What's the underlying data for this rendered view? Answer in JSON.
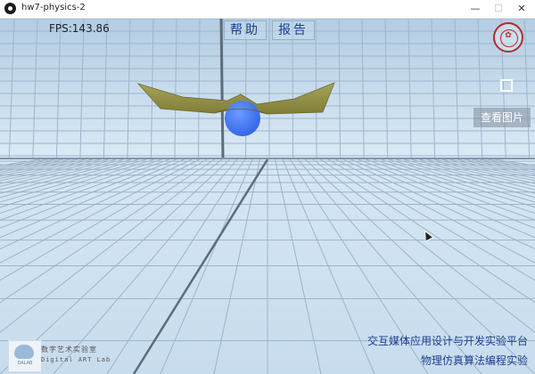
{
  "window": {
    "title": "hw7-physics-2",
    "minimize_glyph": "—",
    "maximize_glyph": "☐",
    "close_glyph": "✕"
  },
  "hud": {
    "fps_text": "FPS:143.86",
    "help_label": "帮助",
    "report_label": "报告",
    "view_image_label": "查看图片",
    "fullscreen_icon": "fullscreen-icon",
    "seal_icon": "university-seal-icon"
  },
  "footer": {
    "line1": "交互媒体应用设计与开发实验平台",
    "line2": "物理仿真算法编程实验"
  },
  "lab_logo": {
    "name_cn": "数字艺术实验室",
    "name_en": "Digital ART Lab",
    "mark": "DALAB"
  },
  "colors": {
    "sky": "#c6dcee",
    "floor": "#cfe2f3",
    "cloth": "#9a9a4a",
    "ball": "#3f78f2",
    "footer_text": "#1d3d93",
    "seal": "#b32b2b"
  }
}
